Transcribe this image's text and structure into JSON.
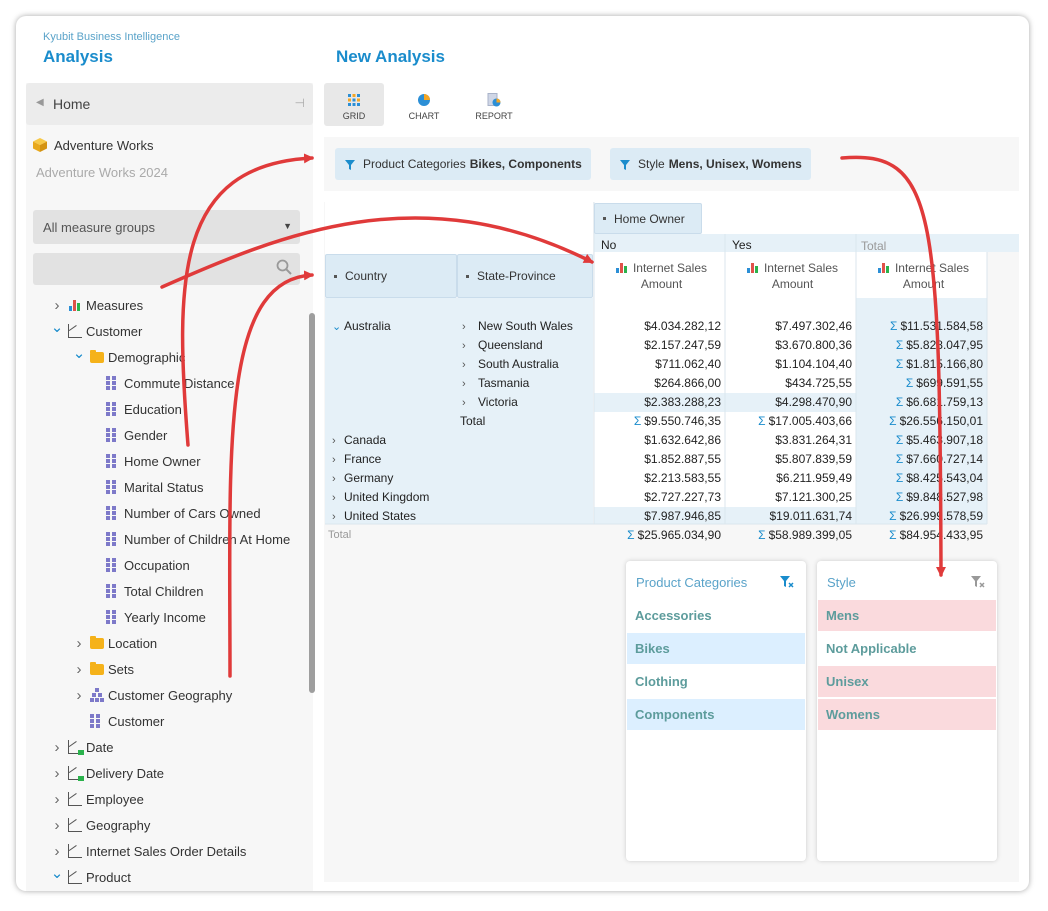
{
  "app": {
    "subtitle": "Kyubit Business Intelligence",
    "title": "Analysis",
    "page_title": "New Analysis"
  },
  "sidebar": {
    "home_label": "Home",
    "cube_name": "Adventure Works",
    "sub_name": "Adventure Works 2024",
    "measure_group": "All measure groups",
    "search_placeholder": "",
    "tree": [
      {
        "label": "Measures",
        "icon": "measures-icon",
        "level": 0,
        "state": "collapsed"
      },
      {
        "label": "Customer",
        "icon": "dimension-icon",
        "level": 0,
        "state": "expanded"
      },
      {
        "label": "Demographic",
        "icon": "folder-icon",
        "level": 1,
        "state": "expanded"
      },
      {
        "label": "Commute Distance",
        "icon": "attribute-icon",
        "level": 2,
        "state": "none"
      },
      {
        "label": "Education",
        "icon": "attribute-icon",
        "level": 2,
        "state": "none"
      },
      {
        "label": "Gender",
        "icon": "attribute-icon",
        "level": 2,
        "state": "none"
      },
      {
        "label": "Home Owner",
        "icon": "attribute-icon",
        "level": 2,
        "state": "none"
      },
      {
        "label": "Marital Status",
        "icon": "attribute-icon",
        "level": 2,
        "state": "none"
      },
      {
        "label": "Number of Cars Owned",
        "icon": "attribute-icon",
        "level": 2,
        "state": "none"
      },
      {
        "label": "Number of Children At Home",
        "icon": "attribute-icon",
        "level": 2,
        "state": "none"
      },
      {
        "label": "Occupation",
        "icon": "attribute-icon",
        "level": 2,
        "state": "none"
      },
      {
        "label": "Total Children",
        "icon": "attribute-icon",
        "level": 2,
        "state": "none"
      },
      {
        "label": "Yearly Income",
        "icon": "attribute-icon",
        "level": 2,
        "state": "none"
      },
      {
        "label": "Location",
        "icon": "folder-icon",
        "level": 1,
        "state": "collapsed"
      },
      {
        "label": "Sets",
        "icon": "folder-icon",
        "level": 1,
        "state": "collapsed"
      },
      {
        "label": "Customer Geography",
        "icon": "hierarchy-icon",
        "level": 1,
        "state": "collapsed"
      },
      {
        "label": "Customer",
        "icon": "attribute-icon",
        "level": 1,
        "state": "none"
      },
      {
        "label": "Date",
        "icon": "date-dimension-icon",
        "level": 0,
        "state": "collapsed"
      },
      {
        "label": "Delivery Date",
        "icon": "date-dimension-icon",
        "level": 0,
        "state": "collapsed"
      },
      {
        "label": "Employee",
        "icon": "dimension-icon",
        "level": 0,
        "state": "collapsed"
      },
      {
        "label": "Geography",
        "icon": "dimension-icon",
        "level": 0,
        "state": "collapsed"
      },
      {
        "label": "Internet Sales Order Details",
        "icon": "dimension-icon",
        "level": 0,
        "state": "collapsed"
      },
      {
        "label": "Product",
        "icon": "dimension-icon",
        "level": 0,
        "state": "expanded"
      }
    ]
  },
  "toolbar": {
    "grid": "GRID",
    "chart": "CHART",
    "report": "REPORT"
  },
  "filters": [
    {
      "name": "Product Categories",
      "values": "Bikes, Components"
    },
    {
      "name": "Style",
      "values": "Mens, Unisex, Womens"
    }
  ],
  "grid": {
    "column_dimension": "Home Owner",
    "column_members": [
      "No",
      "Yes",
      "Total"
    ],
    "row_headers": [
      "Country",
      "State-Province"
    ],
    "measure": "Internet Sales Amount",
    "sigma": "Σ",
    "australia": {
      "country": "Australia",
      "states": [
        {
          "name": "New South Wales",
          "no": "$4.034.282,12",
          "yes": "$7.497.302,46",
          "total": "$11.531.584,58"
        },
        {
          "name": "Queensland",
          "no": "$2.157.247,59",
          "yes": "$3.670.800,36",
          "total": "$5.828.047,95"
        },
        {
          "name": "South Australia",
          "no": "$711.062,40",
          "yes": "$1.104.104,40",
          "total": "$1.815.166,80"
        },
        {
          "name": "Tasmania",
          "no": "$264.866,00",
          "yes": "$434.725,55",
          "total": "$699.591,55"
        },
        {
          "name": "Victoria",
          "no": "$2.383.288,23",
          "yes": "$4.298.470,90",
          "total": "$6.681.759,13"
        }
      ],
      "total_label": "Total",
      "total": {
        "no": "$9.550.746,35",
        "yes": "$17.005.403,66",
        "total": "$26.556.150,01"
      }
    },
    "countries": [
      {
        "name": "Canada",
        "no": "$1.632.642,86",
        "yes": "$3.831.264,31",
        "total": "$5.463.907,18"
      },
      {
        "name": "France",
        "no": "$1.852.887,55",
        "yes": "$5.807.839,59",
        "total": "$7.660.727,14"
      },
      {
        "name": "Germany",
        "no": "$2.213.583,55",
        "yes": "$6.211.959,49",
        "total": "$8.425.543,04"
      },
      {
        "name": "United Kingdom",
        "no": "$2.727.227,73",
        "yes": "$7.121.300,25",
        "total": "$9.848.527,98"
      },
      {
        "name": "United States",
        "no": "$7.987.946,85",
        "yes": "$19.011.631,74",
        "total": "$26.999.578,59"
      }
    ],
    "grand_total_label": "Total",
    "grand_total": {
      "no": "$25.965.034,90",
      "yes": "$58.989.399,05",
      "total": "$84.954.433,95"
    }
  },
  "slicers": [
    {
      "title": "Product Categories",
      "items": [
        {
          "label": "Accessories",
          "selected": false
        },
        {
          "label": "Bikes",
          "selected": true
        },
        {
          "label": "Clothing",
          "selected": false
        },
        {
          "label": "Components",
          "selected": true
        }
      ]
    },
    {
      "title": "Style",
      "items": [
        {
          "label": "Mens",
          "selected": true
        },
        {
          "label": "Not Applicable",
          "selected": false
        },
        {
          "label": "Unisex",
          "selected": true
        },
        {
          "label": "Womens",
          "selected": true
        }
      ]
    }
  ],
  "colors": {
    "accent": "#1a8ccc",
    "header_bg": "#dcebf5",
    "slicer_blue": "#dcefff",
    "slicer_red": "#fadadd",
    "arrow": "#e03a3a"
  }
}
